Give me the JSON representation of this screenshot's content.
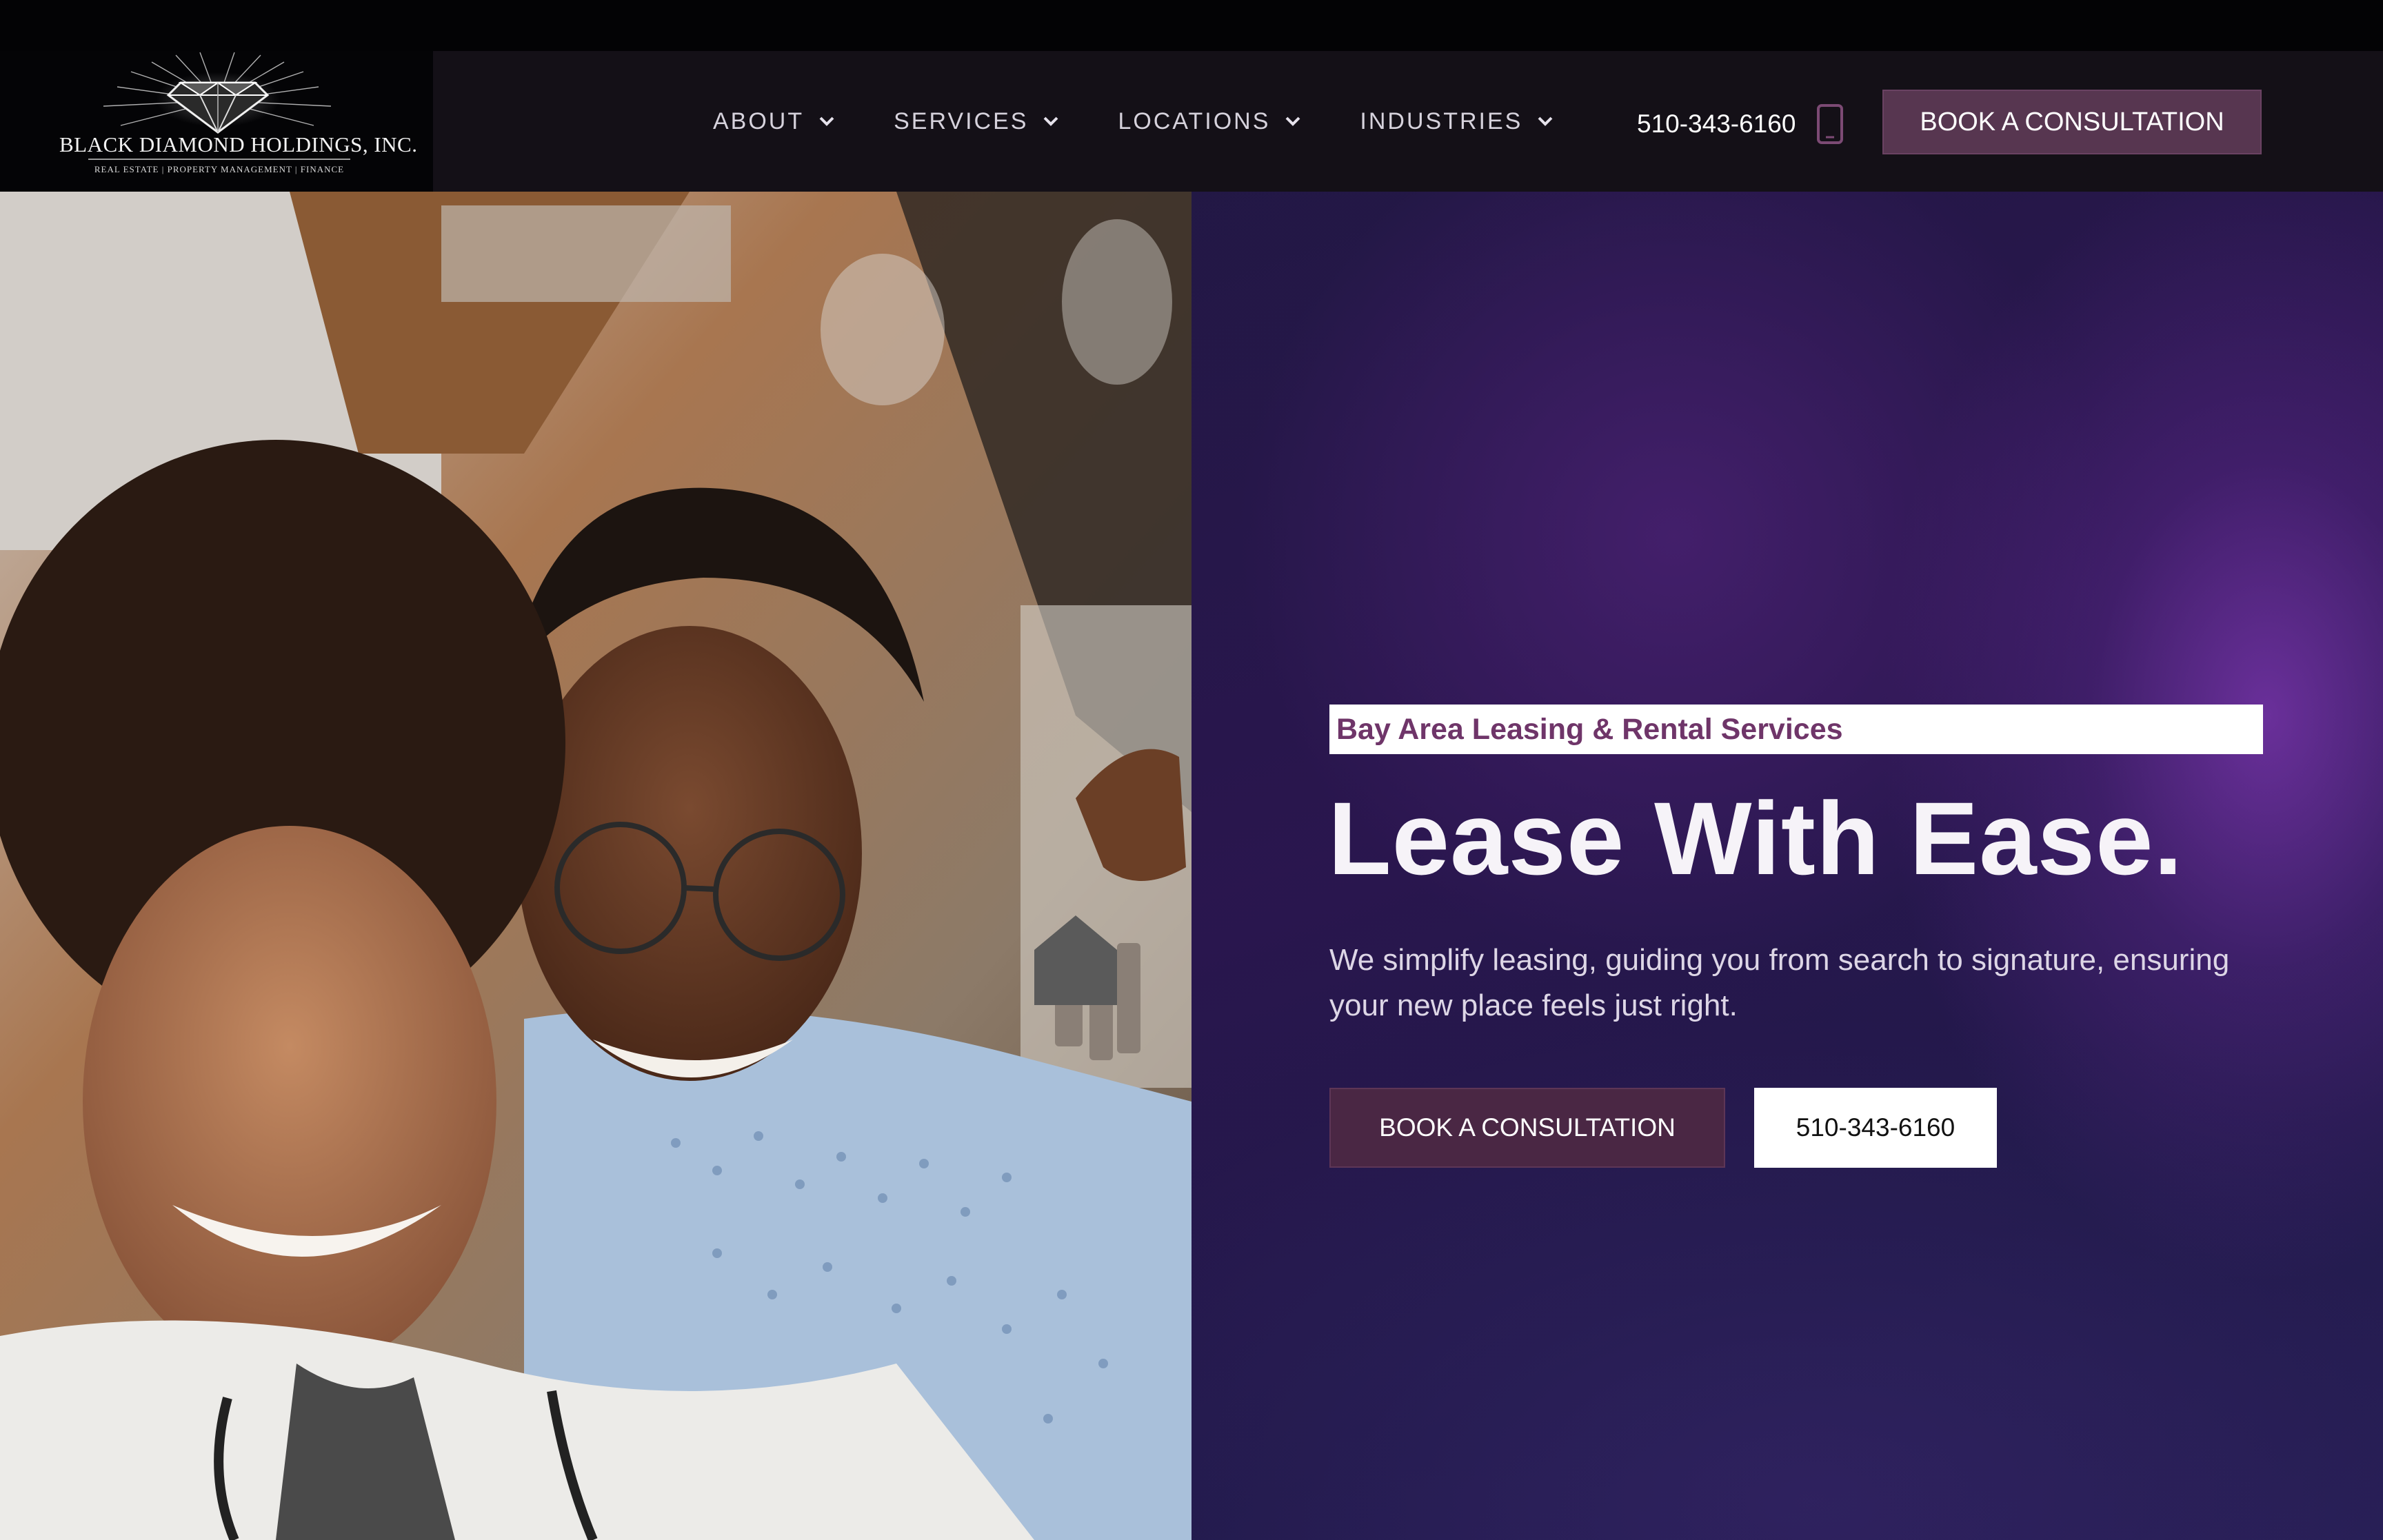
{
  "brand": {
    "name": "BLACK  DIAMOND HOLDINGS, INC.",
    "tagline": "REAL ESTATE | PROPERTY MANAGEMENT | FINANCE",
    "logo_icon": "diamond-icon"
  },
  "nav": {
    "items": [
      {
        "label": "ABOUT",
        "icon": "chevron-down-icon"
      },
      {
        "label": "SERVICES",
        "icon": "chevron-down-icon"
      },
      {
        "label": "LOCATIONS",
        "icon": "chevron-down-icon"
      },
      {
        "label": "INDUSTRIES",
        "icon": "chevron-down-icon"
      }
    ],
    "phone": "510-343-6160",
    "phone_icon": "mobile-phone-icon",
    "cta_label": "BOOK A CONSULTATION"
  },
  "hero": {
    "kicker": "Bay Area Leasing & Rental Services",
    "headline": "Lease With Ease.",
    "subtext": "We simplify leasing, guiding you from search to signature, ensuring your new place feels just right.",
    "primary_button": "BOOK A CONSULTATION",
    "secondary_button": "510-343-6160"
  },
  "colors": {
    "accent": "#573650",
    "kicker_text": "#6f3569",
    "header_bg": "#141017",
    "panel_purple": "#2b1650"
  }
}
